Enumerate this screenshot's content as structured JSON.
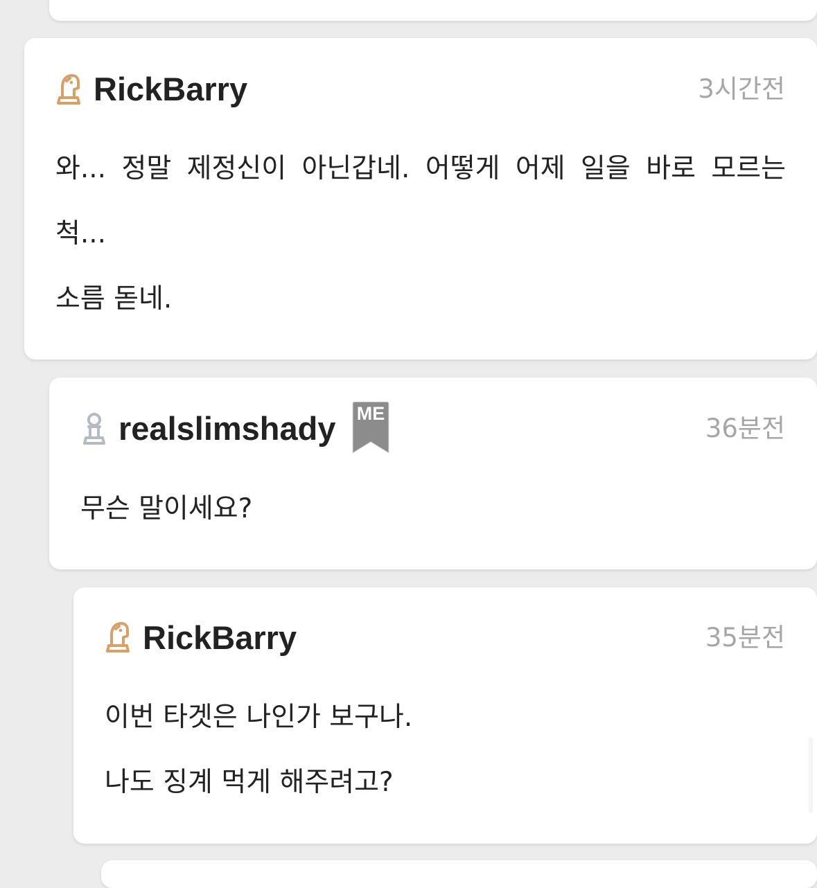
{
  "comments": [
    {
      "username": "RickBarry",
      "time": "3시간전",
      "avatar_icon": "knight-chess-icon",
      "avatar_color": "#d9a066",
      "lines": [
        "와...  정말 제정신이 아닌갑네. 어떻게 어제 일을 바로 모르는 척...",
        "소름 돋네."
      ]
    },
    {
      "username": "realslimshady",
      "time": "36분전",
      "avatar_icon": "pawn-chess-icon",
      "avatar_color": "#b4bac6",
      "badge": "ME",
      "badge_color": "#8c8c8c",
      "lines": [
        "무슨 말이세요?"
      ]
    },
    {
      "username": "RickBarry",
      "time": "35분전",
      "avatar_icon": "knight-chess-icon",
      "avatar_color": "#d9a066",
      "lines": [
        "이번 타겟은 나인가 보구나.",
        "나도 징계 먹게 해주려고?"
      ]
    }
  ]
}
